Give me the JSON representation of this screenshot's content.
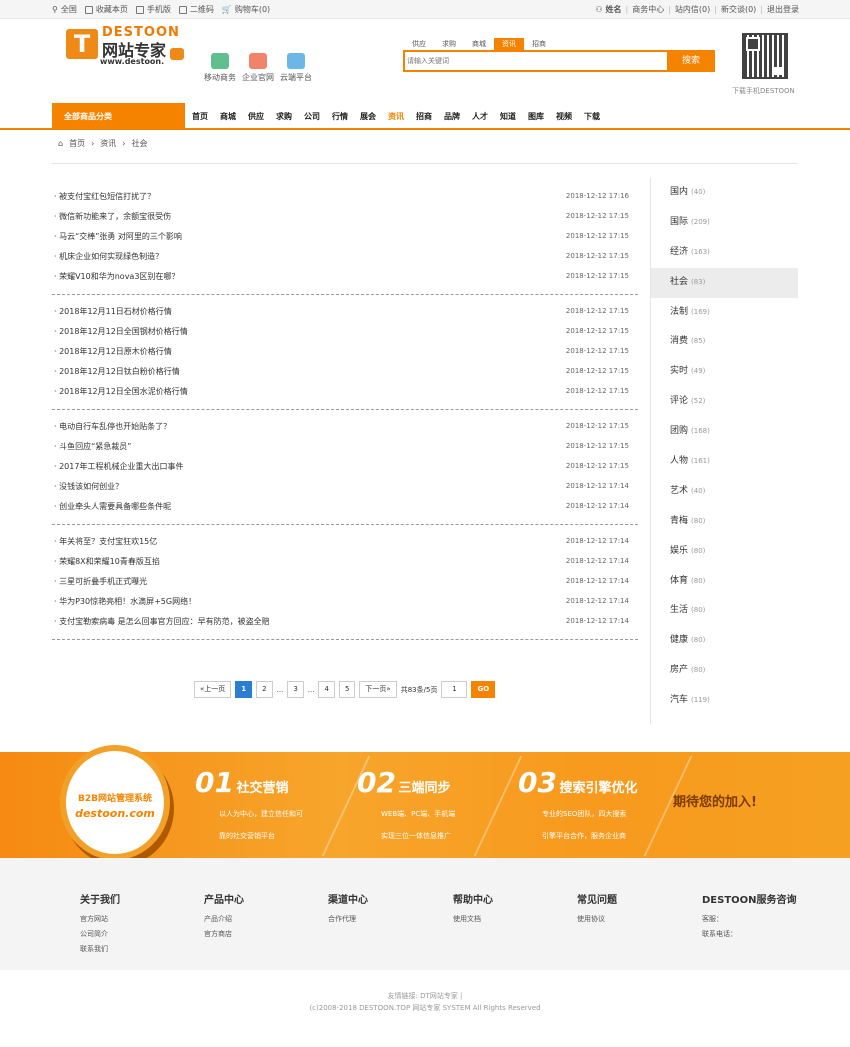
{
  "topbar": {
    "left": [
      "全国",
      "收藏本页",
      "手机版",
      "二维码",
      "购物车(0)"
    ],
    "right": [
      "姓名",
      "商务中心",
      "站内信(0)",
      "新交谈(0)",
      "退出登录"
    ]
  },
  "logo": {
    "brand": "DESTOON",
    "cn": "网站专家",
    "url": "www.destoon."
  },
  "quick": [
    {
      "label": "移动商务",
      "color": "#5fbf8e"
    },
    {
      "label": "企业官网",
      "color": "#f2836b"
    },
    {
      "label": "云端平台",
      "color": "#6db6e8"
    }
  ],
  "search": {
    "tabs": [
      "供应",
      "求购",
      "商城",
      "资讯",
      "招商"
    ],
    "active_tab": "资讯",
    "placeholder": "请输入关键词",
    "button": "搜索"
  },
  "qr_label": "下载手机DESTOON",
  "nav": {
    "category": "全部商品分类",
    "items": [
      "首页",
      "商城",
      "供应",
      "求购",
      "公司",
      "行情",
      "展会",
      "资讯",
      "招商",
      "品牌",
      "人才",
      "知道",
      "图库",
      "视频",
      "下载"
    ],
    "active": "资讯"
  },
  "breadcrumb": [
    "首页",
    "资讯",
    "社会"
  ],
  "groups": [
    [
      {
        "t": "· 被支付宝红包短信打扰了？",
        "d": "2018-12-12 17:16"
      },
      {
        "t": "· 微信新功能来了，余额宝很受伤",
        "d": "2018-12-12 17:15"
      },
      {
        "t": "· 马云“交棒”张勇 对阿里的三个影响",
        "d": "2018-12-12 17:15"
      },
      {
        "t": "· 机床企业如何实现绿色制造？",
        "d": "2018-12-12 17:15"
      },
      {
        "t": "· 荣耀V10和华为nova3区别在哪？",
        "d": "2018-12-12 17:15"
      }
    ],
    [
      {
        "t": "· 2018年12月11日石材价格行情",
        "d": "2018-12-12 17:15"
      },
      {
        "t": "· 2018年12月12日全国钢材价格行情",
        "d": "2018-12-12 17:15"
      },
      {
        "t": "· 2018年12月12日原木价格行情",
        "d": "2018-12-12 17:15"
      },
      {
        "t": "· 2018年12月12日钛白粉价格行情",
        "d": "2018-12-12 17:15"
      },
      {
        "t": "· 2018年12月12日全国水泥价格行情",
        "d": "2018-12-12 17:15"
      }
    ],
    [
      {
        "t": "· 电动自行车乱停也开始贴条了？",
        "d": "2018-12-12 17:15"
      },
      {
        "t": "· 斗鱼回应“紧急裁员”",
        "d": "2018-12-12 17:15"
      },
      {
        "t": "· 2017年工程机械企业重大出口事件",
        "d": "2018-12-12 17:15"
      },
      {
        "t": "· 没钱该如何创业？",
        "d": "2018-12-12 17:14"
      },
      {
        "t": "· 创业牵头人需要具备哪些条件呢",
        "d": "2018-12-12 17:14"
      }
    ],
    [
      {
        "t": "· 年关将至？支付宝狂欢15亿",
        "d": "2018-12-12 17:14"
      },
      {
        "t": "· 荣耀8X和荣耀10青春版互掐",
        "d": "2018-12-12 17:14"
      },
      {
        "t": "· 三星可折叠手机正式曝光",
        "d": "2018-12-12 17:14"
      },
      {
        "t": "· 华为P30惊艳亮相！水滴屏+5G网络！",
        "d": "2018-12-12 17:14"
      },
      {
        "t": "· 支付宝勒索病毒 是怎么回事官方回应：早有防范，被盗全赔",
        "d": "2018-12-12 17:14"
      }
    ]
  ],
  "pager": {
    "prev": "«上一页",
    "pages": [
      "1",
      "2",
      "...",
      "3",
      "...",
      "4",
      "5"
    ],
    "current": "1",
    "next": "下一页»",
    "info": "共83条/5页",
    "input": "1",
    "go": "GO"
  },
  "sidebar": [
    {
      "name": "国内",
      "count": "(40)"
    },
    {
      "name": "国际",
      "count": "(209)"
    },
    {
      "name": "经济",
      "count": "(163)"
    },
    {
      "name": "社会",
      "count": "(83)"
    },
    {
      "name": "法制",
      "count": "(169)"
    },
    {
      "name": "消费",
      "count": "(85)"
    },
    {
      "name": "实时",
      "count": "(49)"
    },
    {
      "name": "评论",
      "count": "(52)"
    },
    {
      "name": "团购",
      "count": "(168)"
    },
    {
      "name": "人物",
      "count": "(161)"
    },
    {
      "name": "艺术",
      "count": "(40)"
    },
    {
      "name": "青梅",
      "count": "(80)"
    },
    {
      "name": "娱乐",
      "count": "(80)"
    },
    {
      "name": "体育",
      "count": "(80)"
    },
    {
      "name": "生活",
      "count": "(80)"
    },
    {
      "name": "健康",
      "count": "(80)"
    },
    {
      "name": "房产",
      "count": "(80)"
    },
    {
      "name": "汽车",
      "count": "(119)"
    }
  ],
  "sidebar_active": "社会",
  "banner": {
    "circle_title": "B2B网站管理系统",
    "circle_sub": "destoon.com",
    "items": [
      {
        "num": "01",
        "label": "社交营销",
        "d1": "以人为中心，建立信任和可",
        "d2": "靠的社交营销平台"
      },
      {
        "num": "02",
        "label": "三端同步",
        "d1": "WEB端、PC端、手机端",
        "d2": "实现三位一体信息推广"
      },
      {
        "num": "03",
        "label": "搜索引擎优化",
        "d1": "专业的SEO团队，四大搜索",
        "d2": "引擎平台合作，服务企业商"
      }
    ],
    "cta": "期待您的加入!"
  },
  "footer": [
    {
      "h": "关于我们",
      "l": [
        "官方网站",
        "公司简介",
        "联系我们"
      ]
    },
    {
      "h": "产品中心",
      "l": [
        "产品介绍",
        "官方商店"
      ]
    },
    {
      "h": "渠道中心",
      "l": [
        "合作代理"
      ]
    },
    {
      "h": "帮助中心",
      "l": [
        "使用文档"
      ]
    },
    {
      "h": "常见问题",
      "l": [
        "使用协议"
      ]
    },
    {
      "h": "DESTOON服务咨询",
      "l": [
        "客服：",
        "联系电话："
      ]
    }
  ],
  "bottom": {
    "links": "友情链接: DT网站专家 |",
    "copyright": "(c)2008-2018 DESTOON.TOP 网站专家 SYSTEM All Rights Reserved"
  }
}
